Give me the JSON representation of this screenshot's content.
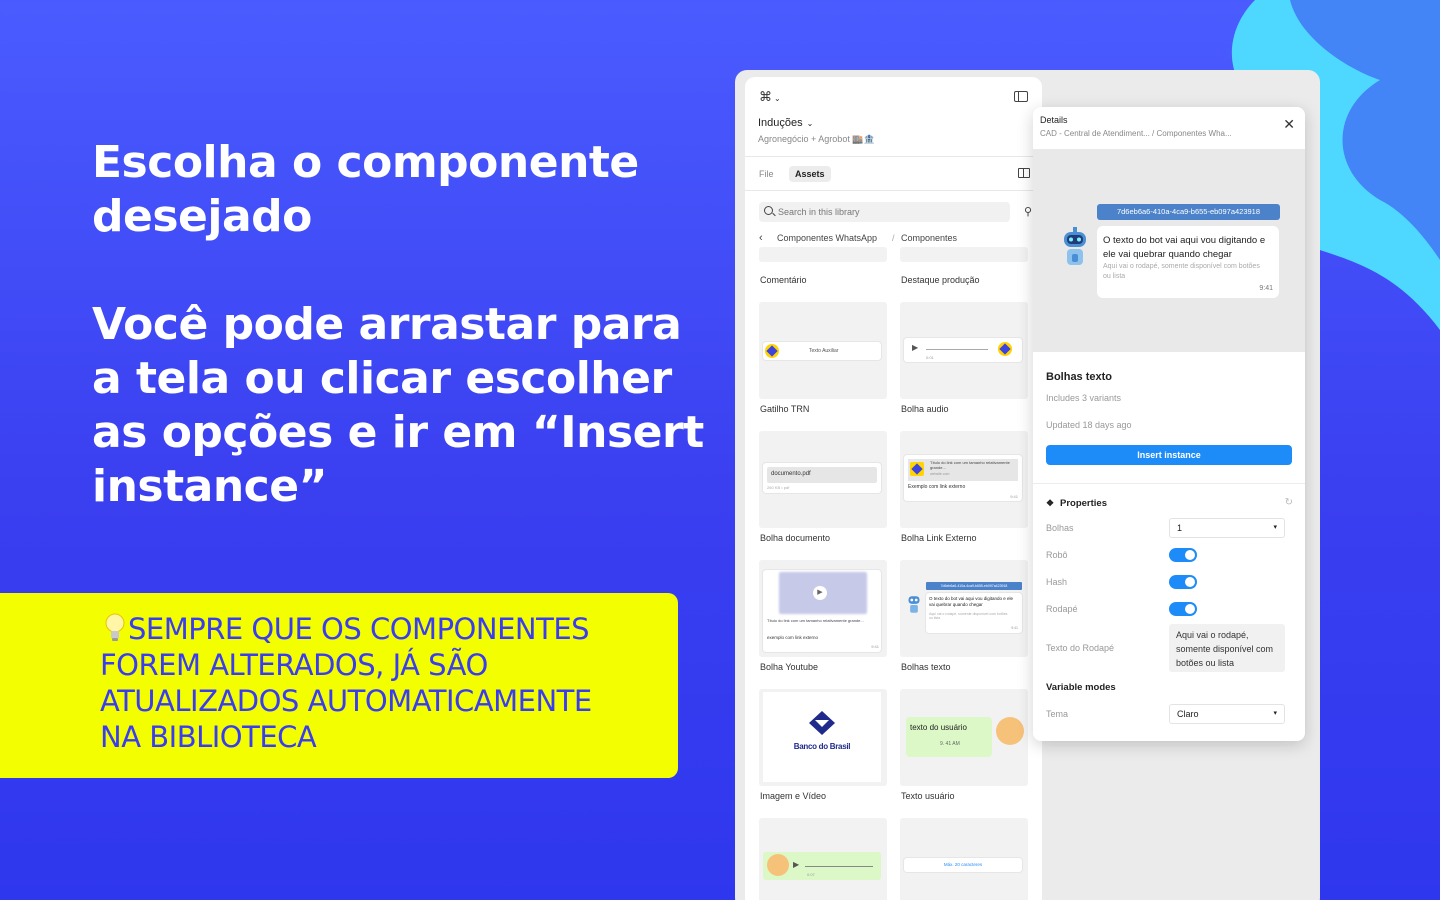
{
  "colors": {
    "bg": "#3a3ff0",
    "note_bg": "#f3ff00",
    "note_text": "#3a3cf0",
    "accent": "#1d8cf8",
    "scallop": "#4fd8ff"
  },
  "headline": {
    "line1": "Escolha o componente desejado",
    "line2": "Você pode arrastar para a tela ou clicar escolher as opções e ir em “Insert instance”"
  },
  "note": {
    "text": "SEMPRE QUE OS COMPONENTES FOREM ALTERADOS, JÁ SÃO ATUALIZADOS AUTOMATICAMENTE NA BIBLIOTECA"
  },
  "assets": {
    "file_name": "Induções",
    "project": "Agronegócio + Agrobot 🏬🏦",
    "tabs": [
      "File",
      "Assets"
    ],
    "search_placeholder": "Search in this library",
    "breadcrumb": [
      "Componentes WhatsApp",
      "Componentes"
    ],
    "tiles": [
      {
        "label": "Comentário"
      },
      {
        "label": "Destaque produção"
      },
      {
        "label": "Gatilho TRN",
        "mini": "Texto Auxiliar"
      },
      {
        "label": "Bolha audio",
        "mini_time": "0:01"
      },
      {
        "label": "Bolha documento",
        "mini": "documento.pdf",
        "mini_sub": "260 KB • pdf"
      },
      {
        "label": "Bolha Link Externo",
        "mini": "Título do link com um tamanho relativamente grande...",
        "mini_sub": "Exemplo com link externo",
        "mini_site": "website.com",
        "mini_time": "9:41"
      },
      {
        "label": "Bolha Youtube",
        "mini": "Título do link com um tamanho relativamente grande...",
        "mini_sub": "exemplo com link externo",
        "mini_time": "9:41"
      },
      {
        "label": "Bolhas texto",
        "mini_hash": "7d6eb6a6-410a-4ca9-b655-eb097a423918",
        "mini": "O texto do bot vai aqui vou digitando e ele vai quebrar quando chegar",
        "mini_sub": "Aqui vai o rodapé, somente disponível com botões ou lista",
        "mini_time": "9:41"
      },
      {
        "label": "Imagem e Vídeo",
        "mini": "Banco do Brasil"
      },
      {
        "label": "Texto usuário",
        "mini": "texto do usuário",
        "mini_time": "9. 41 AM"
      },
      {
        "label": "",
        "mini_time": "0:07"
      },
      {
        "label": "",
        "mini": "Máx. 20 caracteres"
      }
    ]
  },
  "details": {
    "title": "Details",
    "path": "CAD - Central de Atendiment... / Componentes Wha...",
    "preview": {
      "hash": "7d6eb6a6-410a-4ca9-b655-eb097a423918",
      "message": "O texto do bot vai aqui vou digitando e ele vai quebrar quando chegar",
      "footer": "Aqui vai o rodapé, somente disponível com botões ou lista",
      "time": "9:41"
    },
    "component_name": "Bolhas texto",
    "variants": "Includes 3 variants",
    "updated": "Updated 18 days ago",
    "insert_label": "Insert instance",
    "properties_title": "Properties",
    "properties": {
      "bolhas_label": "Bolhas",
      "bolhas_value": "1",
      "robo_label": "Robô",
      "robo_on": true,
      "hash_label": "Hash",
      "hash_on": true,
      "rodape_label": "Rodapé",
      "rodape_on": true,
      "texto_rodape_label": "Texto do Rodapé",
      "texto_rodape_value": "Aqui vai o rodapé, somente disponível com botões ou lista"
    },
    "variable_modes_title": "Variable modes",
    "tema_label": "Tema",
    "tema_value": "Claro"
  }
}
